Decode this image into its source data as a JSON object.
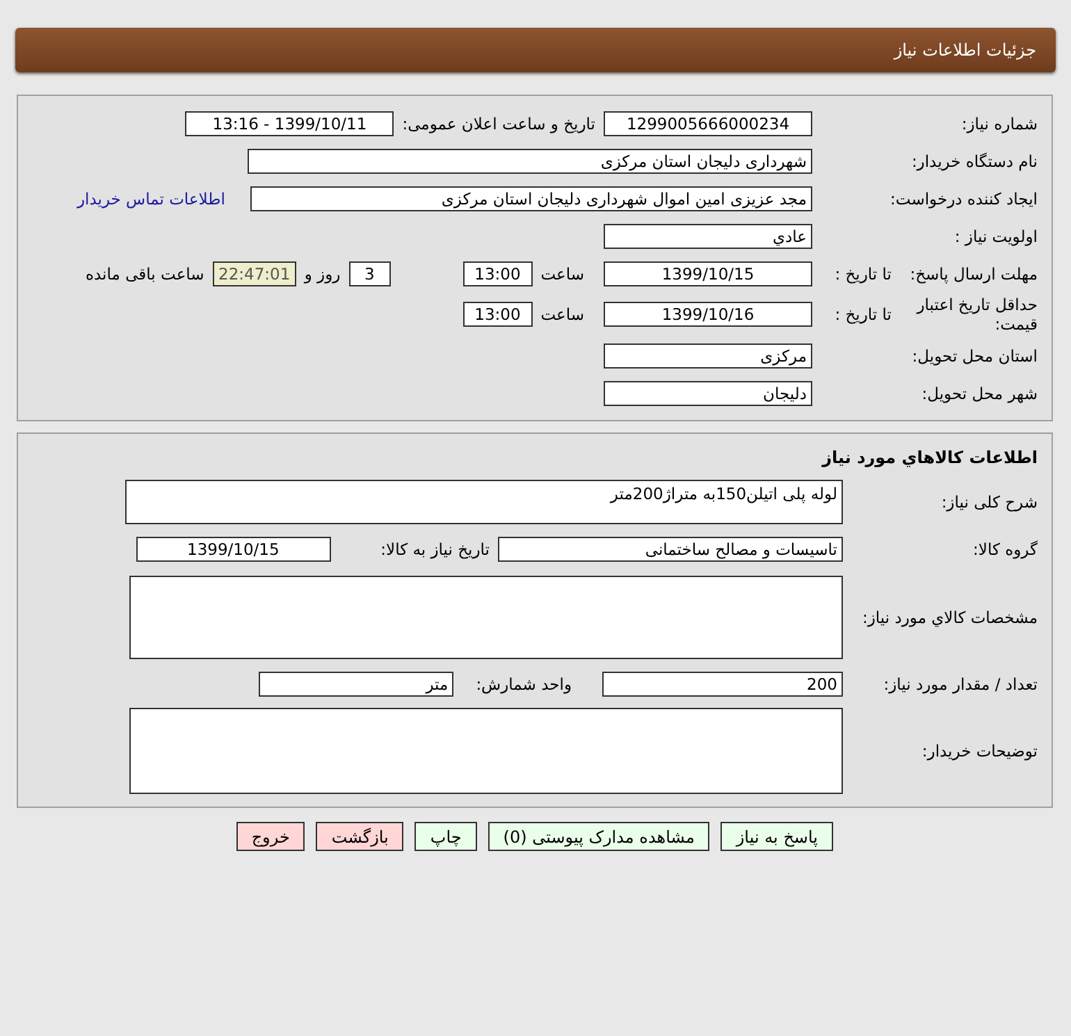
{
  "header": {
    "title": "جزئیات اطلاعات نیاز"
  },
  "need": {
    "need_number": {
      "label": "شماره نیاز:",
      "value": "1299005666000234"
    },
    "announce": {
      "label": "تاریخ و ساعت اعلان عمومی:",
      "value": "1399/10/11 - 13:16"
    },
    "buyer_org": {
      "label": "نام دستگاه خریدار:",
      "value": "شهرداری دلیجان استان مرکزی"
    },
    "requester": {
      "label": "ایجاد کننده درخواست:",
      "value": "مجد عزیزی امین اموال شهرداری دلیجان استان مرکزی",
      "link": "اطلاعات تماس خریدار"
    },
    "priority": {
      "label": "اولویت نیاز :",
      "value": "عادي"
    },
    "deadline": {
      "label": "مهلت ارسال پاسخ:",
      "date_label": "تا تاریخ :",
      "date": "1399/10/15",
      "time_label": "ساعت",
      "time": "13:00",
      "days": "3",
      "days_label": "روز و",
      "remaining": "22:47:01",
      "remaining_label": "ساعت باقی مانده"
    },
    "validity": {
      "label": "حداقل تاریخ اعتبار قیمت:",
      "date_label": "تا تاریخ :",
      "date": "1399/10/16",
      "time_label": "ساعت",
      "time": "13:00"
    },
    "province": {
      "label": "استان محل تحویل:",
      "value": "مرکزی"
    },
    "city": {
      "label": "شهر محل تحویل:",
      "value": "دلیجان"
    }
  },
  "goods": {
    "title": "اطلاعات کالاهاي مورد نیاز",
    "description": {
      "label": "شرح کلی نیاز:",
      "value": "لوله پلی اتیلن150به متراژ200متر"
    },
    "group": {
      "label": "گروه کالا:",
      "value": "تاسیسات و مصالح ساختمانی",
      "date_label": "تاریخ نیاز به کالا:",
      "date": "1399/10/15"
    },
    "specs": {
      "label": "مشخصات کالاي مورد نیاز:"
    },
    "quantity": {
      "label": "تعداد / مقدار مورد نیاز:",
      "value": "200",
      "unit_label": "واحد شمارش:",
      "unit": "متر"
    },
    "buyer_notes": {
      "label": "توضیحات خریدار:"
    }
  },
  "buttons": [
    {
      "label": "پاسخ به نیاز",
      "kind": "action"
    },
    {
      "label": "مشاهده مدارک پیوستی (0)",
      "kind": "action"
    },
    {
      "label": "چاپ",
      "kind": "action"
    },
    {
      "label": "بازگشت",
      "kind": "exit"
    },
    {
      "label": "خروج",
      "kind": "exit"
    }
  ]
}
